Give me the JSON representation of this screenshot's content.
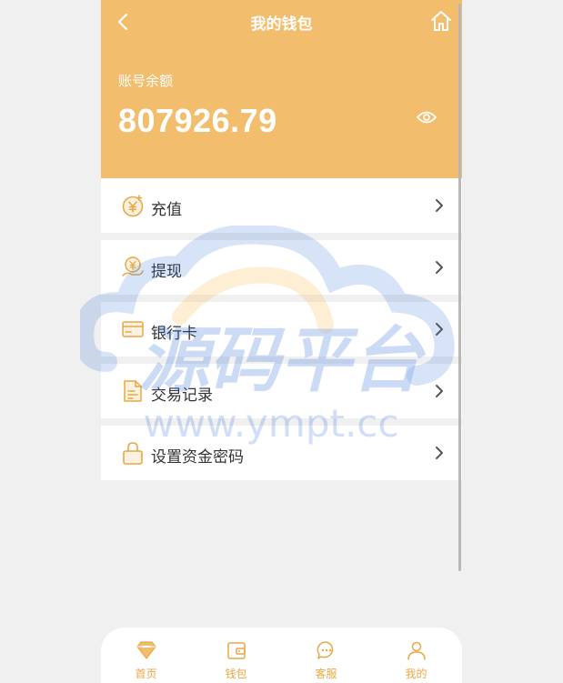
{
  "header": {
    "title": "我的钱包",
    "balance_label": "账号余额",
    "balance_value": "807926.79"
  },
  "menu": [
    {
      "label": "充值",
      "icon": "yuan-coin-icon"
    },
    {
      "label": "提现",
      "icon": "hand-coin-icon"
    },
    {
      "label": "银行卡",
      "icon": "bank-card-icon"
    },
    {
      "label": "交易记录",
      "icon": "document-icon"
    },
    {
      "label": "设置资金密码",
      "icon": "lock-icon"
    }
  ],
  "watermark": {
    "title": "源码平台",
    "url": "www.ympt.cc"
  },
  "tabbar": [
    {
      "label": "首页",
      "icon": "diamond-icon"
    },
    {
      "label": "钱包",
      "icon": "wallet-icon"
    },
    {
      "label": "客服",
      "icon": "chat-icon"
    },
    {
      "label": "我的",
      "icon": "user-icon"
    }
  ],
  "colors": {
    "header_bg": "#f2bd6c",
    "accent": "#e8a743",
    "page_bg": "#f0f0f0",
    "watermark_blue": "#2f6fd8",
    "watermark_orange": "#f5a623"
  }
}
